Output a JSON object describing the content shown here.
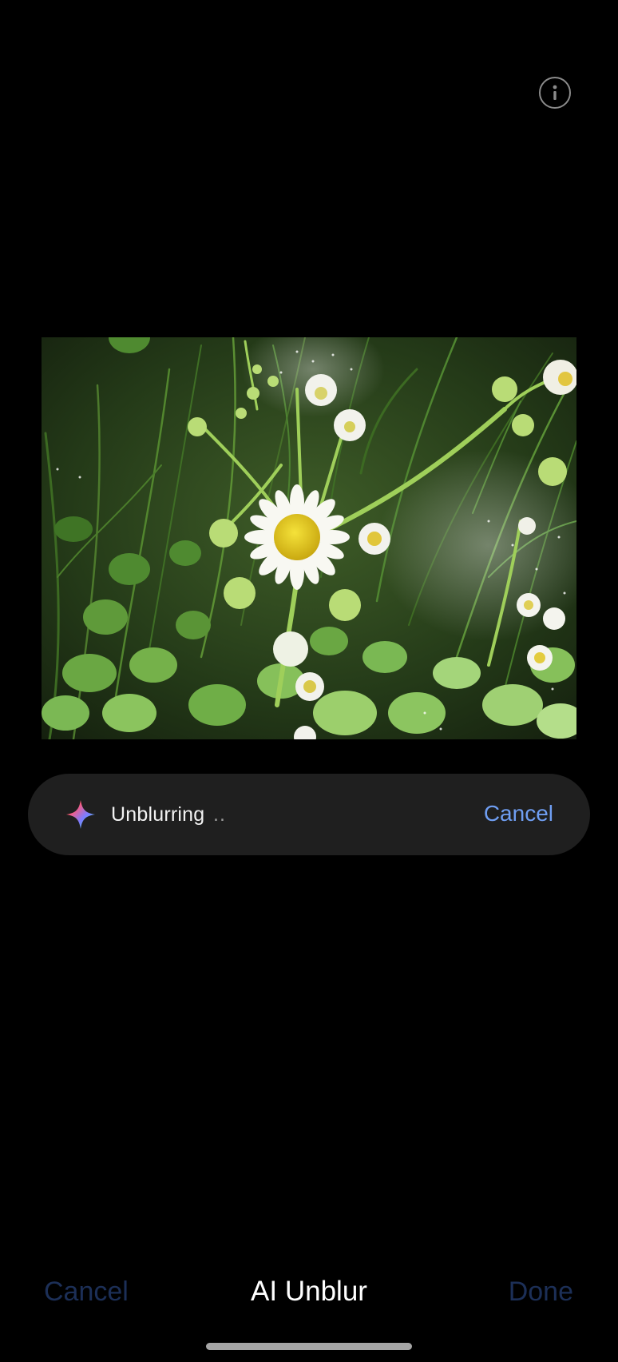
{
  "top_bar": {
    "info_icon": "info-icon"
  },
  "photo": {
    "subject": "daisy-flowers-photo"
  },
  "status": {
    "icon": "sparkle-icon",
    "text": "Unblurring",
    "dots": "..",
    "cancel_label": "Cancel",
    "accent_color": "#6f9ef2"
  },
  "bottom_bar": {
    "cancel_label": "Cancel",
    "title": "AI Unblur",
    "done_label": "Done",
    "disabled_color": "#1c2f57"
  }
}
